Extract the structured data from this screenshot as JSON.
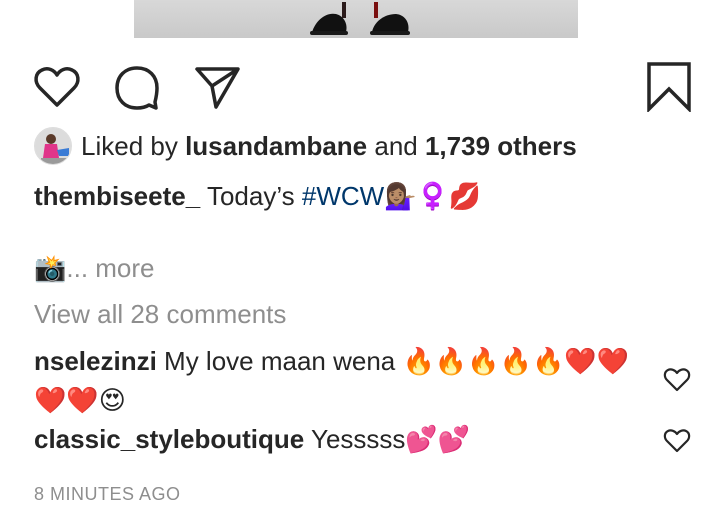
{
  "post": {
    "liked_by_prefix": "Liked by ",
    "liked_by_user": "lusandambane",
    "liked_and": " and ",
    "liked_count": "1,739 others",
    "caption_user": "thembiseete_",
    "caption_text": " Today’s ",
    "caption_hashtag": "#WCW",
    "caption_emojis": "💁🏽‍♀️♀️💋",
    "camera_emoji": "📸",
    "more_label": "... more",
    "view_all_comments": "View all 28 comments",
    "timestamp": "8 MINUTES AGO"
  },
  "comments": [
    {
      "user": "nselezinzi",
      "text": " My love maan wena ",
      "emojis": "🔥🔥🔥🔥🔥❤️❤️",
      "emojis2": "❤️❤️😍"
    },
    {
      "user": "classic_styleboutique",
      "text": " Yesssss",
      "emojis": "💕💕"
    }
  ],
  "icons": {
    "like": "heart-icon",
    "comment": "comment-bubble-icon",
    "share": "paper-plane-icon",
    "save": "bookmark-icon"
  },
  "colors": {
    "text": "#262626",
    "muted": "#8e8e8e",
    "hashtag": "#00376b"
  }
}
